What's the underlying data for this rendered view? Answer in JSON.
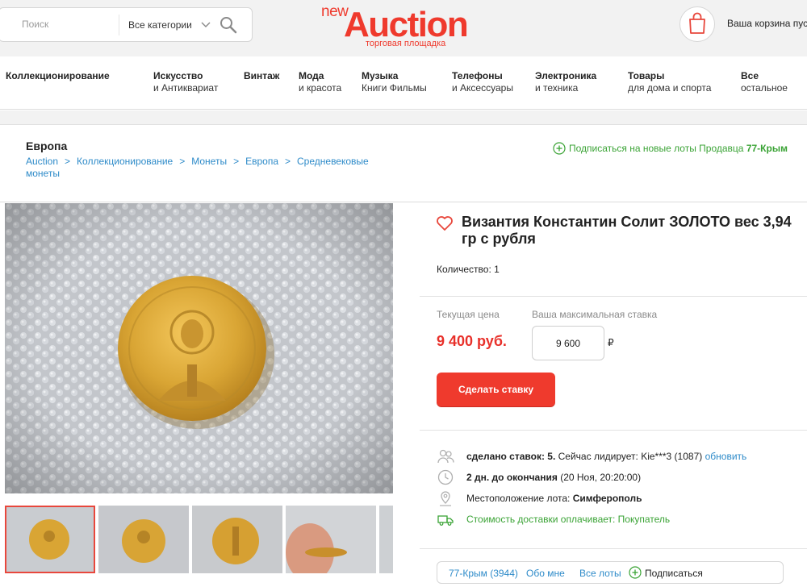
{
  "header": {
    "search_placeholder": "Поиск",
    "category_select": "Все категории",
    "logo_prefix": "new",
    "logo_main": "Auction",
    "logo_tagline": "торговая площадка",
    "cart_label": "Ваша корзина пуст",
    "brand_color": "#ef3a2d"
  },
  "nav": {
    "items": [
      {
        "line1": "Коллекционирование",
        "line2": ""
      },
      {
        "line1": "Искусство",
        "line2": "и Антиквариат"
      },
      {
        "line1": "Винтаж",
        "line2": ""
      },
      {
        "line1": "Мода",
        "line2": "и красота"
      },
      {
        "line1": "Музыка",
        "line2": "Книги Фильмы"
      },
      {
        "line1": "Телефоны",
        "line2": "и Аксессуары"
      },
      {
        "line1": "Электроника",
        "line2": "и техника"
      },
      {
        "line1": "Товары",
        "line2": "для дома и спорта"
      },
      {
        "line1": "Все",
        "line2": "остальное"
      }
    ]
  },
  "page": {
    "section_title": "Европа",
    "breadcrumb": [
      "Auction",
      "Коллекционирование",
      "Монеты",
      "Европа",
      "Средневековые монеты"
    ],
    "subscribe_text": "Подписаться на новые лоты Продавца",
    "subscribe_seller": "77-Крым"
  },
  "lot": {
    "title": "Византия Константин Солит ЗОЛОТО вес 3,94 гр с рубля",
    "quantity": "Количество: 1",
    "current_price_label": "Текущая цена",
    "current_price": "9 400 руб.",
    "max_bid_label": "Ваша максимальная ставка",
    "max_bid_value": "9 600",
    "currency_symbol": "₽",
    "bid_button": "Сделать ставку",
    "bids_label": "сделано ставок: 5.",
    "leader_text": "Сейчас лидирует: Kie***3 (1087)",
    "refresh_link": "обновить",
    "time_left": "2 дн. до окончания",
    "end_date": "(20 Ноя, 20:20:00)",
    "location_label": "Местоположение лота:",
    "location_value": "Симферополь",
    "shipping_text": "Стоимость доставки оплачивает: Покупатель"
  },
  "seller_bar": {
    "seller": "77-Крым (3944)",
    "about": "Обо мне",
    "all_lots": "Все лоты",
    "subscribe": "Подписаться"
  }
}
